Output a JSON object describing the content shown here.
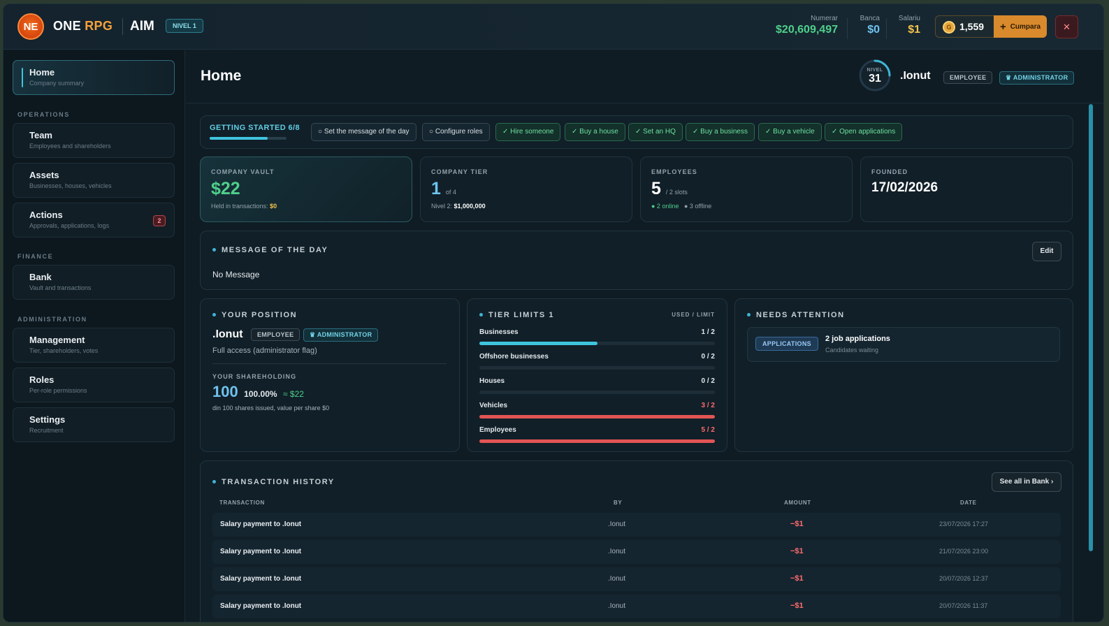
{
  "app": {
    "logo_text": "NE",
    "brand_one": "ONE",
    "brand_rpg": "RPG",
    "company": "AIM",
    "level_chip": "NIVEL 1"
  },
  "money": {
    "cash_label": "Numerar",
    "cash_value": "$20,609,497",
    "bank_label": "Banca",
    "bank_value": "$0",
    "salary_label": "Salariu",
    "salary_value": "$1",
    "coin_icon_text": "G",
    "coins": "1,559",
    "buy_label": "Cumpara",
    "close_glyph": "✕"
  },
  "sidebar": {
    "home": {
      "title": "Home",
      "sub": "Company summary"
    },
    "sections": {
      "operations": "OPERATIONS",
      "finance": "FINANCE",
      "administration": "ADMINISTRATION"
    },
    "team": {
      "title": "Team",
      "sub": "Employees and shareholders"
    },
    "assets": {
      "title": "Assets",
      "sub": "Businesses, houses, vehicles"
    },
    "actions": {
      "title": "Actions",
      "sub": "Approvals, applications, logs",
      "badge": "2"
    },
    "bank": {
      "title": "Bank",
      "sub": "Vault and transactions"
    },
    "management": {
      "title": "Management",
      "sub": "Tier, shareholders, votes"
    },
    "roles": {
      "title": "Roles",
      "sub": "Per-role permissions"
    },
    "settings": {
      "title": "Settings",
      "sub": "Recruitment"
    }
  },
  "header": {
    "title": "Home",
    "level_label": "NIVEL",
    "level": "31",
    "level_progress": 0.25,
    "user": ".Ionut",
    "role_chip": "EMPLOYEE",
    "admin_chip": "♛ ADMINISTRATOR"
  },
  "getting_started": {
    "title": "GETTING STARTED 6/8",
    "progress": 0.75,
    "steps": [
      {
        "label": "○ Set the message of the day",
        "done": false
      },
      {
        "label": "○ Configure roles",
        "done": false
      },
      {
        "label": "✓ Hire someone",
        "done": true
      },
      {
        "label": "✓ Buy a house",
        "done": true
      },
      {
        "label": "✓ Set an HQ",
        "done": true
      },
      {
        "label": "✓ Buy a business",
        "done": true
      },
      {
        "label": "✓ Buy a vehicle",
        "done": true
      },
      {
        "label": "✓ Open applications",
        "done": true
      }
    ]
  },
  "stats": {
    "vault": {
      "label": "COMPANY VAULT",
      "value": "$22",
      "sub_prefix": "Held in transactions:",
      "sub_value": "$0"
    },
    "tier": {
      "label": "COMPANY TIER",
      "value": "1",
      "of": "of 4",
      "sub_prefix": "Nivel 2:",
      "sub_value": "$1,000,000"
    },
    "employees": {
      "label": "EMPLOYEES",
      "value": "5",
      "slots": "/ 2 slots",
      "online": "● 2 online",
      "offline": "● 3 offline"
    },
    "founded": {
      "label": "FOUNDED",
      "value": "17/02/2026"
    }
  },
  "motd": {
    "title": "MESSAGE OF THE DAY",
    "edit": "Edit",
    "text": "No Message"
  },
  "position": {
    "title": "YOUR POSITION",
    "name": ".Ionut",
    "role_chip": "EMPLOYEE",
    "admin_chip": "♛ ADMINISTRATOR",
    "access": "Full access (administrator flag)",
    "share_label": "YOUR SHAREHOLDING",
    "shares": "100",
    "percent": "100.00%",
    "approx": "≈ $22",
    "note": "din 100 shares issued, value per share $0"
  },
  "limits": {
    "title": "TIER LIMITS 1",
    "legend": "USED / LIMIT",
    "rows": [
      {
        "name": "Businesses",
        "value": "1 / 2",
        "fill": 0.5,
        "over": false
      },
      {
        "name": "Offshore businesses",
        "value": "0 / 2",
        "fill": 0,
        "over": false
      },
      {
        "name": "Houses",
        "value": "0 / 2",
        "fill": 0,
        "over": false
      },
      {
        "name": "Vehicles",
        "value": "3 / 2",
        "fill": 1,
        "over": true
      },
      {
        "name": "Employees",
        "value": "5 / 2",
        "fill": 1,
        "over": true
      }
    ]
  },
  "attention": {
    "title": "NEEDS ATTENTION",
    "chip": "APPLICATIONS",
    "item_title": "2 job applications",
    "item_sub": "Candidates waiting"
  },
  "transactions": {
    "title": "TRANSACTION HISTORY",
    "see_all": "See all in Bank ›",
    "headers": {
      "transaction": "TRANSACTION",
      "by": "BY",
      "amount": "AMOUNT",
      "date": "DATE"
    },
    "rows": [
      {
        "desc": "Salary payment to .Ionut",
        "by": ".Ionut",
        "amount": "−$1",
        "date": "23/07/2026 17:27"
      },
      {
        "desc": "Salary payment to .Ionut",
        "by": ".Ionut",
        "amount": "−$1",
        "date": "21/07/2026 23:00"
      },
      {
        "desc": "Salary payment to .Ionut",
        "by": ".Ionut",
        "amount": "−$1",
        "date": "20/07/2026 12:37"
      },
      {
        "desc": "Salary payment to .Ionut",
        "by": ".Ionut",
        "amount": "−$1",
        "date": "20/07/2026 11:37"
      }
    ]
  },
  "colors": {
    "accent": "#3fc4de",
    "cash": "#4fd08a",
    "bank": "#6fc3ee",
    "salary": "#f5c44b",
    "danger": "#e25555",
    "vault": "#4fd08a",
    "tier": "#6fc3ee"
  }
}
